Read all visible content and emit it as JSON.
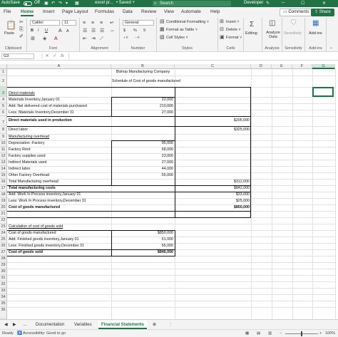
{
  "titlebar": {
    "autosave_label": "AutoSave",
    "autosave_state": "Off",
    "filename": "excel pr...",
    "saved": "• Saved ˅",
    "search_placeholder": "Search",
    "user": "Developer"
  },
  "ribbon_tabs": [
    "File",
    "Home",
    "Insert",
    "Page Layout",
    "Formulas",
    "Data",
    "Review",
    "View",
    "Automate",
    "Help"
  ],
  "active_tab": "Home",
  "ribbon_buttons": {
    "comments": "Comments",
    "share": "Share"
  },
  "ribbon": {
    "clipboard": {
      "paste": "Paste",
      "label": "Clipboard"
    },
    "font": {
      "name": "Calibri",
      "size": "11",
      "bold": "B",
      "italic": "I",
      "underline": "U",
      "grow": "A",
      "shrink": "A",
      "label": "Font"
    },
    "alignment": {
      "label": "Alignment"
    },
    "number": {
      "format": "General",
      "currency": "$",
      "percent": "%",
      "comma": "9",
      "label": "Number"
    },
    "styles": {
      "conditional": "Conditional Formatting ˅",
      "table": "Format as Table ˅",
      "cell": "Cell Styles ˅",
      "label": "Styles"
    },
    "cells": {
      "insert": "Insert ˅",
      "delete": "Delete ˅",
      "format": "Format ˅",
      "label": "Cells"
    },
    "editing": {
      "label": "Editing"
    },
    "analysis": {
      "analyze": "Analyze Data",
      "label": "Analysis"
    },
    "sensitivity": {
      "button": "Sensitivity",
      "label": "Sensitivity"
    },
    "addins": {
      "button": "Add-ins",
      "label": "Add-ins"
    }
  },
  "formula_bar": {
    "name_box": "G3",
    "cancel": "✕",
    "enter": "✓",
    "fx": "fx",
    "value": ""
  },
  "columns": [
    "A",
    "B",
    "C",
    "D",
    "E",
    "F",
    "G"
  ],
  "selected_column": "G",
  "selected_cell": "G3",
  "rows": [
    "1",
    "2",
    "3",
    "4",
    "5",
    "6",
    "7",
    "8",
    "9",
    "10",
    "11",
    "12",
    "13",
    "14",
    "15",
    "16",
    "17",
    "18",
    "19",
    "20",
    "21",
    "22",
    "23",
    "24",
    "25",
    "26",
    "27",
    "28",
    "29",
    "30",
    "31",
    "32",
    "33",
    "34",
    "35",
    "36"
  ],
  "sheet": {
    "r1": {
      "b": "Bishop Manufacturing Company"
    },
    "r2": {
      "b": "Schedule of Cost of goods manufactured"
    },
    "r3": {
      "a": "Direct materials"
    },
    "r4": {
      "a": "Materials Inventory,January 01",
      "b": "22,000"
    },
    "r5": {
      "a": "Add: Net delivered cost of materials purchased",
      "b": "210,000"
    },
    "r6": {
      "a": "Less: Materials Inventory,December 31",
      "b": "27,000"
    },
    "r7": {
      "a": "Direct materials used in production",
      "c": "$205,000"
    },
    "r8": {
      "a": "Direct labor",
      "c": "$325,000"
    },
    "r9": {
      "a": "Manufacturing overhead"
    },
    "r10": {
      "a": "Depreciation -Factory",
      "b": "95,000"
    },
    "r11": {
      "a": "Factory Rent",
      "b": "68,000"
    },
    "r12": {
      "a": "Factory supplies used",
      "b": "23,000"
    },
    "r13": {
      "a": "Indirect Materials used",
      "b": "27,000"
    },
    "r14": {
      "a": "Indirect labor",
      "b": "44,000"
    },
    "r15": {
      "a": "Other Factory Overhead",
      "b": "55,000"
    },
    "r16": {
      "a": "Total Manufacturing overhead",
      "c": "$312,000"
    },
    "r17": {
      "a": "Total manufacturing costs",
      "c": "$842,000"
    },
    "r18": {
      "a": "Add: Work In Process inventory,January 01",
      "c": "$33,000"
    },
    "r19": {
      "a": "Less: Work In Process inventory,December 31",
      "c": "$25,000"
    },
    "r20": {
      "a": "Cost of goods manufactured",
      "c": "$850,000"
    },
    "r22": {
      "a": "Calculation of cost of goods sold"
    },
    "r23": {
      "a": "Cost of goods manufactured",
      "b": "$850,000"
    },
    "r24": {
      "a": "Add: Finished goods inventory,January 01",
      "b": "61,000"
    },
    "r25": {
      "a": "Less: Finished goods inventory,December 31",
      "b": "65,000"
    },
    "r26": {
      "a": "Cost of goods sold",
      "b": "$846,000"
    }
  },
  "sheet_tabs": [
    "Documentation",
    "Variables",
    "Financial Statements"
  ],
  "active_sheet": "Financial Statements",
  "status": {
    "ready": "Ready",
    "accessibility": "Accessibility: Good to go",
    "zoom": "100%"
  }
}
